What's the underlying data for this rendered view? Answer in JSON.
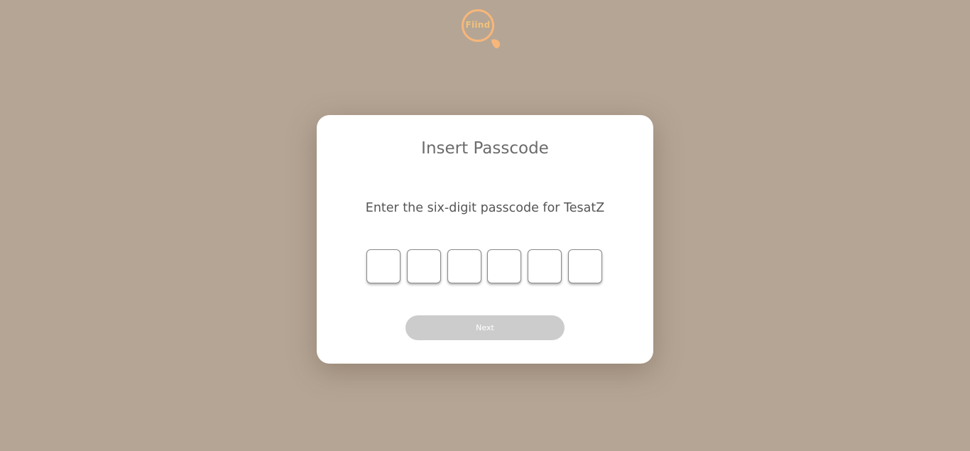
{
  "logo": {
    "text": "Fiind",
    "ring_color": "#f7b67a",
    "text_color": "#f2c27a"
  },
  "card": {
    "title": "Insert Passcode",
    "subtitle": "Enter the six-digit passcode for TesatZ",
    "code_digits": [
      "",
      "",
      "",
      "",
      "",
      ""
    ],
    "next_label": "Next",
    "next_disabled": true
  },
  "colors": {
    "background": "#b5a595",
    "button_disabled": "#cccccc"
  }
}
